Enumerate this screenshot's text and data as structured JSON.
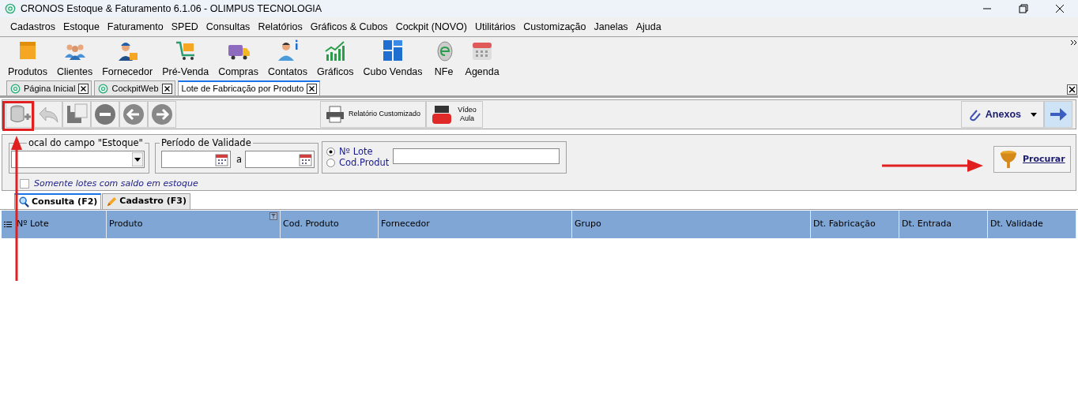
{
  "window": {
    "title": "CRONOS Estoque & Faturamento 6.1.06 - OLIMPUS TECNOLOGIA"
  },
  "menu": [
    "Cadastros",
    "Estoque",
    "Faturamento",
    "SPED",
    "Consultas",
    "Relatórios",
    "Gráficos & Cubos",
    "Cockpit (NOVO)",
    "Utilitários",
    "Customização",
    "Janelas",
    "Ajuda"
  ],
  "toolbar": [
    "Produtos",
    "Clientes",
    "Fornecedor",
    "Pré-Venda",
    "Compras",
    "Contatos",
    "Gráficos",
    "Cubo Vendas",
    "NFe",
    "Agenda"
  ],
  "doc_tabs": [
    {
      "label": "Página Inicial",
      "selected": false
    },
    {
      "label": "CockpitWeb",
      "selected": false
    },
    {
      "label": "Lote de Fabricação por Produto",
      "selected": true
    }
  ],
  "actions": {
    "report": "Relatório Customizado",
    "video": "Vídeo Aula",
    "attachments": "Anexos"
  },
  "filters": {
    "local_label": "ocal do campo \"Estoque\"",
    "period_label": "Período de Validade",
    "period_separator": "a",
    "radios": [
      {
        "label": "Nº Lote",
        "selected": true
      },
      {
        "label": "Cod.Produt",
        "selected": false
      }
    ],
    "only_balance": {
      "label": "Somente lotes com saldo em estoque",
      "checked": false
    },
    "search_button": "Procurar"
  },
  "inner_tabs": [
    {
      "label": "Consulta (F2)",
      "selected": true
    },
    {
      "label": "Cadastro (F3)",
      "selected": false
    }
  ],
  "table": {
    "columns": [
      "Nº Lote",
      "Produto",
      "Cod. Produto",
      "Fornecedor",
      "Grupo",
      "Dt. Fabricação",
      "Dt. Entrada",
      "Dt. Validade"
    ]
  },
  "annotations": [
    {
      "kind": "box",
      "color": "#e02020"
    },
    {
      "kind": "arrow-up",
      "color": "#e02020"
    },
    {
      "kind": "arrow-right",
      "color": "#e02020"
    }
  ]
}
